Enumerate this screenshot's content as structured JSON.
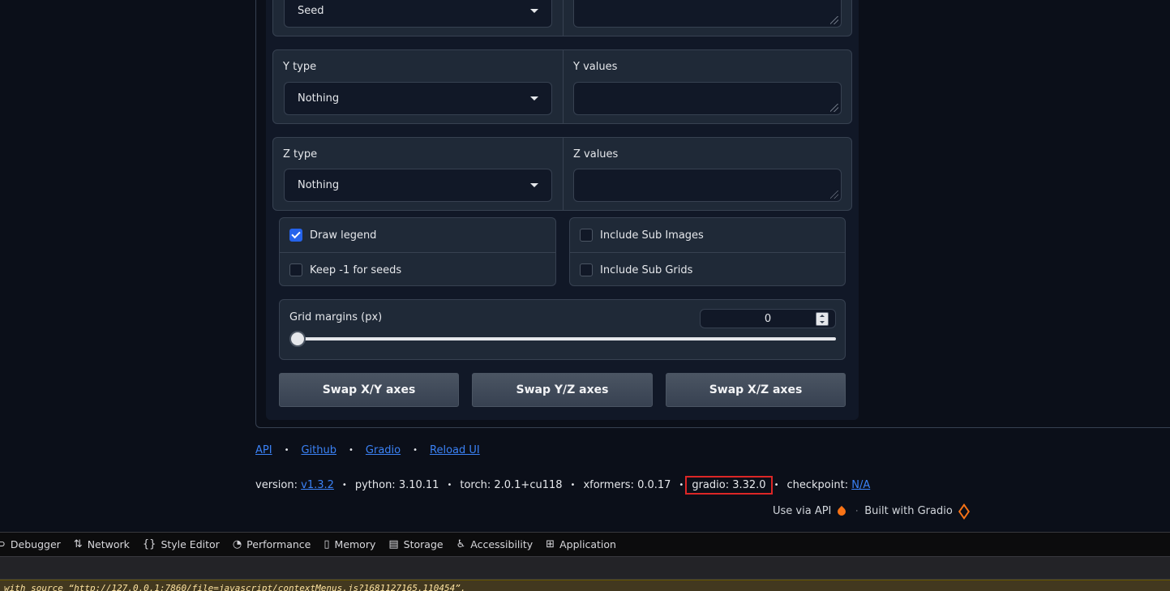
{
  "x_row": {
    "type_value": "Seed"
  },
  "y_row": {
    "type_label": "Y type",
    "type_value": "Nothing",
    "values_label": "Y values"
  },
  "z_row": {
    "type_label": "Z type",
    "type_value": "Nothing",
    "values_label": "Z values"
  },
  "options_left": [
    {
      "label": "Draw legend",
      "checked": true
    },
    {
      "label": "Keep -1 for seeds",
      "checked": false
    }
  ],
  "options_right": [
    {
      "label": "Include Sub Images",
      "checked": false
    },
    {
      "label": "Include Sub Grids",
      "checked": false
    }
  ],
  "grid_margins": {
    "label": "Grid margins (px)",
    "value": "0",
    "slider_fraction": 0.0
  },
  "buttons": {
    "swap_xy": "Swap X/Y axes",
    "swap_yz": "Swap Y/Z axes",
    "swap_xz": "Swap X/Z axes"
  },
  "footer": {
    "links": [
      "API",
      "Github",
      "Gradio",
      "Reload UI"
    ],
    "version_label": "version:",
    "version_value": "v1.3.2",
    "python": "python: 3.10.11",
    "torch": "torch: 2.0.1+cu118",
    "xformers": "xformers: 0.0.17",
    "gradio": "gradio: 3.32.0",
    "checkpoint_label": "checkpoint:",
    "checkpoint_value": "N/A",
    "use_via_api": "Use via API",
    "built_with": "Built with Gradio"
  },
  "devtools": {
    "tabs": [
      "Debugger",
      "Network",
      "Style Editor",
      "Performance",
      "Memory",
      "Storage",
      "Accessibility",
      "Application"
    ],
    "console_line": "with source “http://127.0.0.1:7860/file=javascript/contextMenus.js?1681127165.110454”."
  },
  "colors": {
    "accent": "#2563eb",
    "link": "#3b82f6",
    "highlight": "#dc2626",
    "gradio_orange": "#f97316"
  }
}
